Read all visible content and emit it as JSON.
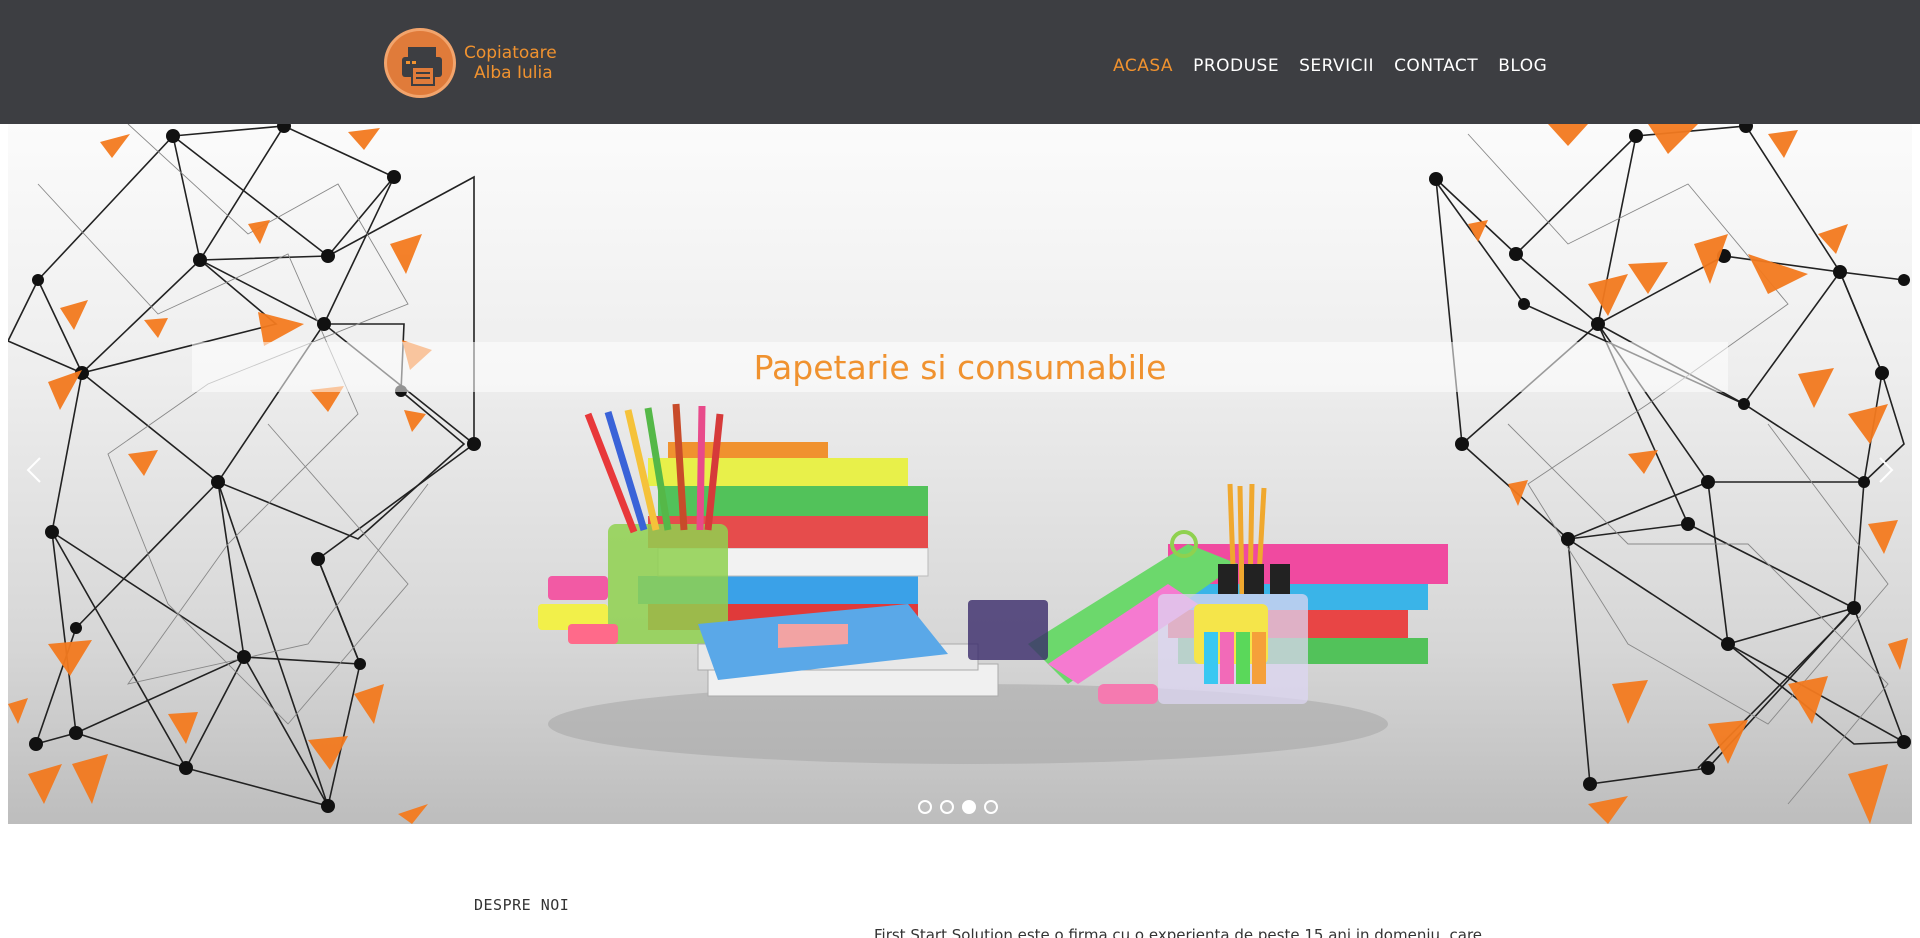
{
  "header": {
    "logo": {
      "line1": "Copiatoare",
      "line2": "Alba Iulia",
      "icon": "printer-icon"
    },
    "nav": [
      {
        "label": "ACASA",
        "active": true
      },
      {
        "label": "PRODUSE",
        "active": false
      },
      {
        "label": "SERVICII",
        "active": false
      },
      {
        "label": "CONTACT",
        "active": false
      },
      {
        "label": "BLOG",
        "active": false
      }
    ]
  },
  "slider": {
    "caption": "Papetarie si consumabile",
    "prev_icon": "chevron-left-icon",
    "next_icon": "chevron-right-icon",
    "slide_count": 4,
    "active_slide": 3
  },
  "about": {
    "heading": "DESPRE NOI",
    "intro": "First Start Solution este o firma cu o experienta de peste 15 ani in domeniu, care"
  },
  "colors": {
    "header_bg": "#3d3e42",
    "accent": "#f0922f",
    "text": "#333333"
  }
}
